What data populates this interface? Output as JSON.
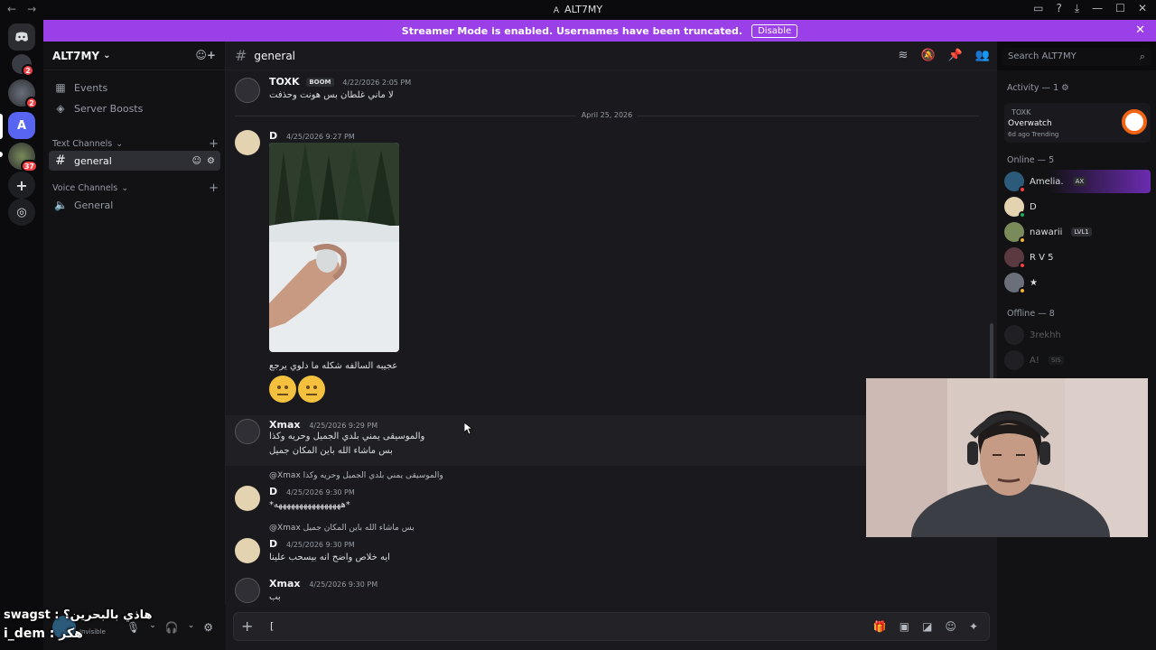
{
  "window": {
    "title": "ALT7MY",
    "back": "←",
    "forward": "→",
    "controls": [
      "▭",
      "?",
      "⤓",
      "—",
      "☐",
      "✕"
    ]
  },
  "rail": {
    "discord_icon": "discord-icon",
    "badges": [
      "2",
      "2",
      "37"
    ],
    "active_server_letter": "A"
  },
  "banner": {
    "text": "Streamer Mode is enabled. Usernames have been truncated.",
    "disable_label": "Disable",
    "close": "✕"
  },
  "sidebar": {
    "server_name": "ALT7MY",
    "chevron": "⌄",
    "items": [
      {
        "label": "Events",
        "icon": "calendar-icon"
      },
      {
        "label": "Server Boosts",
        "icon": "boost-icon"
      }
    ],
    "text_category": "Text Channels",
    "voice_category": "Voice Channels",
    "text_channel": "general",
    "voice_channel": "General"
  },
  "user_panel": {
    "status": "Invisible"
  },
  "overlay": {
    "line1": "swagst : هاذي بالبحرين؟",
    "line2": "i_dem : هكر"
  },
  "chat": {
    "channel": "general",
    "search_placeholder": "Search ALT7MY",
    "date_divider": "April 25, 2026",
    "messages": [
      {
        "author": "TOXK",
        "tag": "BOOM",
        "ts": "4/22/2026 2:05 PM",
        "text": "لا ماني غلطان بس هونت وحذفت"
      },
      {
        "author": "D",
        "ts": "4/25/2026 9:27 PM",
        "text": "عجيبه السالفه شكله ما دلوي يرجع"
      },
      {
        "author": "Xmax",
        "ts": "4/25/2026 9:29 PM",
        "text": "والموسيقى يمني بلدي الجميل وحريه وكذا",
        "text2": "بس ماشاء الله باين المكان جميل"
      },
      {
        "reply": "@Xmax والموسيقى يمني بلدي الجميل وحريه وكذا",
        "author": "D",
        "ts": "4/25/2026 9:30 PM",
        "text": "*ههههههههههههههههه*"
      },
      {
        "reply": "@Xmax بس ماشاء الله باين المكان جميل",
        "author": "D",
        "ts": "4/25/2026 9:30 PM",
        "text": "ايه خلاص واضح انه بيسحب علينا"
      },
      {
        "author": "Xmax",
        "ts": "4/25/2026 9:30 PM",
        "text": "بب"
      }
    ],
    "composer_plus": "+",
    "composer_value": "["
  },
  "members": {
    "activity_header": "Activity — 1",
    "activity_user": "TOXK",
    "activity_game": "Overwatch",
    "activity_meta": "6d ago  Trending",
    "online_header": "Online — 5",
    "online": [
      {
        "name": "Amelia.",
        "tag": "AX"
      },
      {
        "name": "D",
        "tag": ""
      },
      {
        "name": "nawarii",
        "tag": "LVL1"
      },
      {
        "name": "R V 5",
        "tag": ""
      },
      {
        "name": "★",
        "tag": ""
      }
    ],
    "offline_header": "Offline — 8",
    "offline": [
      {
        "name": "3rekhh",
        "tag": ""
      },
      {
        "name": "A!",
        "tag": "SIS"
      }
    ]
  },
  "colors": {
    "banner": "#9b3fe8",
    "bg": "#1a1a1e",
    "sidebar": "#121214",
    "online": "#23a55a",
    "idle": "#f0b232",
    "dnd": "#f23f43"
  }
}
